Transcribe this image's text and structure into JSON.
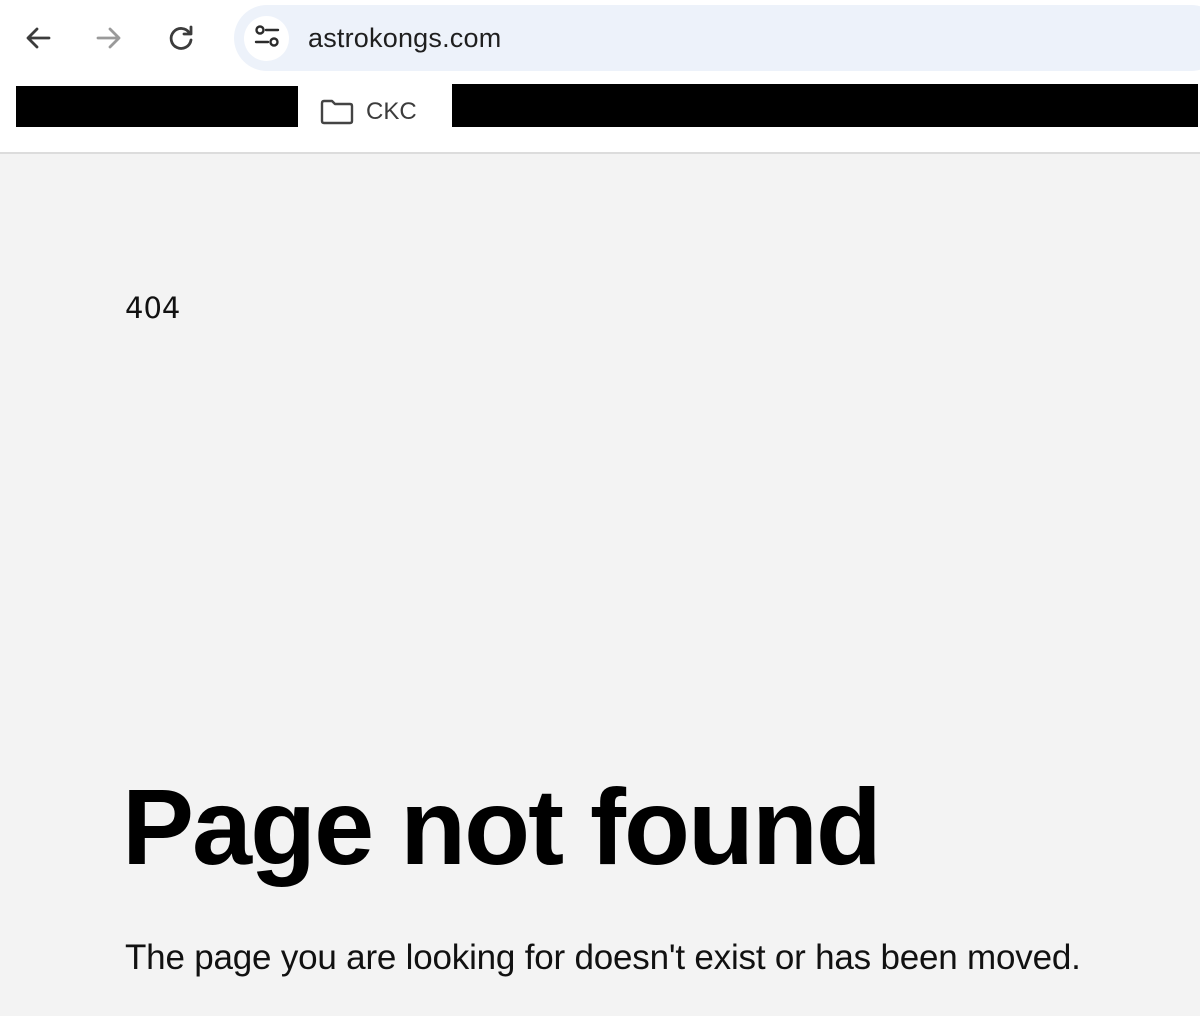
{
  "browser": {
    "url": "astrokongs.com",
    "icons": {
      "back": "arrow-left-icon",
      "forward": "arrow-right-icon",
      "reload": "reload-icon",
      "site_info": "tune-icon",
      "folder": "folder-icon"
    }
  },
  "bookmarks": {
    "folder_label": "CKC"
  },
  "page": {
    "error_code": "404",
    "title": "Page not found",
    "message": "The page you are looking for doesn't exist or has been moved."
  },
  "colors": {
    "page_background": "#f3f3f3",
    "omnibox_background": "#edf2fa",
    "text": "#000000"
  }
}
